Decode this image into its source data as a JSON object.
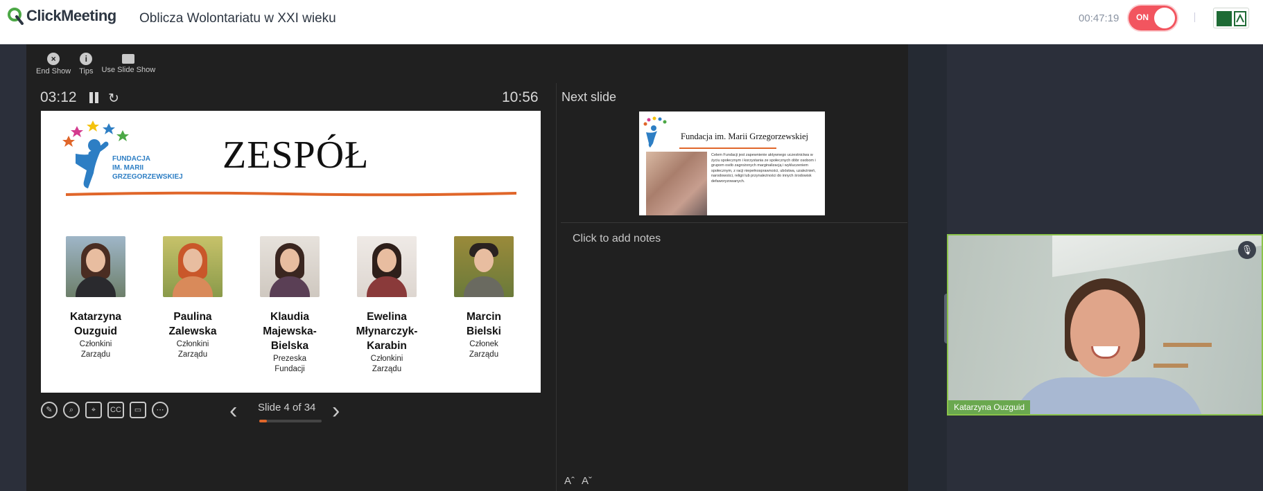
{
  "app": {
    "brand": "ClickMeeting",
    "meeting_title": "Oblicza Wolontariatu w XXI wieku",
    "session_timer": "00:47:19",
    "recording_label": "ON"
  },
  "toolbar": {
    "end_show": "End Show",
    "tips": "Tips",
    "use_slide_show": "Use Slide Show"
  },
  "presenter": {
    "elapsed": "03:12",
    "clock": "10:56",
    "next_slide_label": "Next slide",
    "notes_placeholder": "Click to add notes",
    "slide_counter": "Slide 4 of 34",
    "progress_fraction": 0.1176
  },
  "slide": {
    "title": "ZESPÓŁ",
    "logo_lines": [
      "FUNDACJA",
      "IM. MARII",
      "GRZEGORZEWSKIEJ"
    ],
    "members": [
      {
        "name_lines": [
          "Katarzyna",
          "Ouzguid"
        ],
        "role_lines": [
          "Członkini",
          "Zarządu"
        ]
      },
      {
        "name_lines": [
          "Paulina",
          "Zalewska"
        ],
        "role_lines": [
          "Członkini",
          "Zarządu"
        ]
      },
      {
        "name_lines": [
          "Klaudia",
          "Majewska-",
          "Bielska"
        ],
        "role_lines": [
          "Prezeska",
          "Fundacji"
        ]
      },
      {
        "name_lines": [
          "Ewelina",
          "Młynarczyk-",
          "Karabin"
        ],
        "role_lines": [
          "Członkini",
          "Zarządu"
        ]
      },
      {
        "name_lines": [
          "Marcin",
          "Bielski"
        ],
        "role_lines": [
          "Członek",
          "Zarządu"
        ]
      }
    ]
  },
  "next_slide": {
    "title": "Fundacja im. Marii Grzegorzewskiej",
    "body": "Celem Fundacji jest zapewnienie aktywnego uczestnictwa w życiu społecznym i korzystania ze społecznych dóbr osobom i grupom osób zagrożonych marginalizacją i wykluczeniem społecznym, z racji niepełnosprawności, ubóstwa, uzależnień, narodowości, religii lub przynależności do innych środowisk defaworyzowanych."
  },
  "video": {
    "participant_name": "Katarzyna Ouzguid"
  },
  "colors": {
    "brand_green": "#6aa84f",
    "record_red": "#f2555f",
    "accent_orange": "#e0662a"
  }
}
